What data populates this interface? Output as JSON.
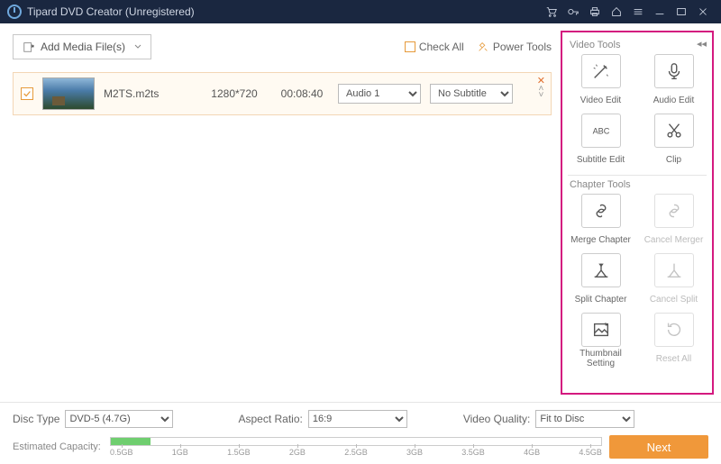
{
  "titlebar": {
    "title": "Tipard DVD Creator (Unregistered)"
  },
  "toolbar": {
    "add_media": "Add Media File(s)",
    "check_all": "Check All",
    "power_tools": "Power Tools"
  },
  "file": {
    "name": "M2TS.m2ts",
    "resolution": "1280*720",
    "duration": "00:08:40",
    "audio_selected": "Audio 1",
    "subtitle_selected": "No Subtitle"
  },
  "video_tools": {
    "title": "Video Tools",
    "edit": "Video Edit",
    "audio": "Audio Edit",
    "subtitle": "Subtitle Edit",
    "clip": "Clip"
  },
  "chapter_tools": {
    "title": "Chapter Tools",
    "merge": "Merge Chapter",
    "cancel_merge": "Cancel Merger",
    "split": "Split Chapter",
    "cancel_split": "Cancel Split",
    "thumbnail": "Thumbnail Setting",
    "reset": "Reset All"
  },
  "bottom": {
    "disc_type_label": "Disc Type",
    "disc_type": "DVD-5 (4.7G)",
    "aspect_label": "Aspect Ratio:",
    "aspect": "16:9",
    "quality_label": "Video Quality:",
    "quality": "Fit to Disc",
    "capacity_label": "Estimated Capacity:",
    "ticks": [
      "0.5GB",
      "1GB",
      "1.5GB",
      "2GB",
      "2.5GB",
      "3GB",
      "3.5GB",
      "4GB",
      "4.5GB"
    ],
    "fill_percent": 8,
    "next": "Next"
  }
}
